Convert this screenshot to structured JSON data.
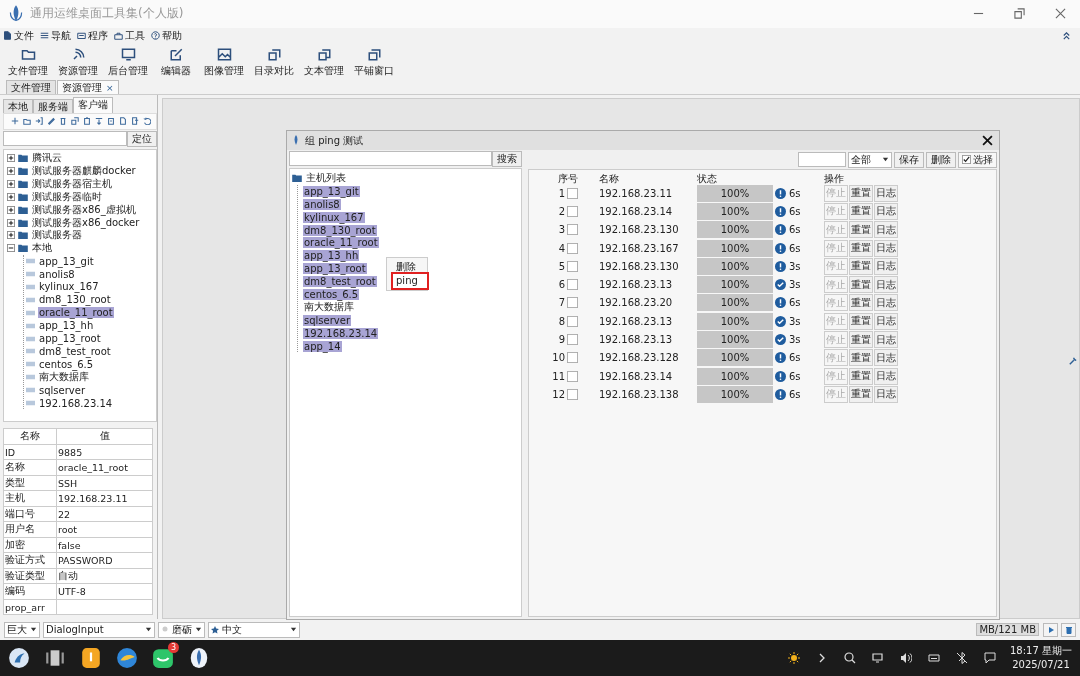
{
  "window": {
    "title": "通用运维桌面工具集(个人版)"
  },
  "menu": [
    "文件",
    "导航",
    "程序",
    "工具",
    "帮助"
  ],
  "toolbar": [
    "文件管理",
    "资源管理",
    "后台管理",
    "编辑器",
    "图像管理",
    "目录对比",
    "文本管理",
    "平铺窗口"
  ],
  "doc_tabs": [
    {
      "label": "文件管理",
      "selected": false
    },
    {
      "label": "资源管理",
      "selected": true,
      "close": "×"
    }
  ],
  "left_panel": {
    "tabs": [
      {
        "label": "本地",
        "selected": false
      },
      {
        "label": "服务端",
        "selected": false
      },
      {
        "label": "客户端",
        "selected": true
      }
    ],
    "locate_button": "定位",
    "tree": [
      {
        "label": "腾讯云",
        "expanded": false
      },
      {
        "label": "测试服务器麒麟docker",
        "expanded": false
      },
      {
        "label": "测试服务器宿主机",
        "expanded": false
      },
      {
        "label": "测试服务器临时",
        "expanded": false
      },
      {
        "label": "测试服务器x86_虚拟机",
        "expanded": false
      },
      {
        "label": "测试服务器x86_docker",
        "expanded": false
      },
      {
        "label": "测试服务器",
        "expanded": false
      },
      {
        "label": "本地",
        "expanded": true,
        "children": [
          {
            "label": "app_13_git",
            "selected": false
          },
          {
            "label": "anolis8",
            "selected": false
          },
          {
            "label": "kylinux_167",
            "selected": false
          },
          {
            "label": "dm8_130_root",
            "selected": false
          },
          {
            "label": "oracle_11_root",
            "selected": true
          },
          {
            "label": "app_13_hh",
            "selected": false
          },
          {
            "label": "app_13_root",
            "selected": false
          },
          {
            "label": "dm8_test_root",
            "selected": false
          },
          {
            "label": "centos_6.5",
            "selected": false
          },
          {
            "label": "南大数据库",
            "selected": false
          },
          {
            "label": "sqlserver",
            "selected": false
          },
          {
            "label": "192.168.23.14",
            "selected": false
          }
        ]
      }
    ],
    "properties": {
      "columns": [
        "名称",
        "值"
      ],
      "rows": [
        {
          "key": "ID",
          "value": "9885"
        },
        {
          "key": "名称",
          "value": "oracle_11_root"
        },
        {
          "key": "类型",
          "value": "SSH"
        },
        {
          "key": "主机",
          "value": "192.168.23.11"
        },
        {
          "key": "端口号",
          "value": "22"
        },
        {
          "key": "用户名",
          "value": "root"
        },
        {
          "key": "加密",
          "value": "false"
        },
        {
          "key": "验证方式",
          "value": "PASSWORD"
        },
        {
          "key": "验证类型",
          "value": "自动"
        },
        {
          "key": "编码",
          "value": "UTF-8"
        },
        {
          "key": "prop_arr"
        }
      ]
    }
  },
  "dialog": {
    "title": "组 ping 测试",
    "search_button": "搜索",
    "tree": {
      "label": "主机列表",
      "children": [
        {
          "label": "app_13_git",
          "selected": true
        },
        {
          "label": "anolis8",
          "selected": true
        },
        {
          "label": "kylinux_167",
          "selected": true
        },
        {
          "label": "dm8_130_root",
          "selected": true
        },
        {
          "label": "oracle_11_root",
          "selected": true
        },
        {
          "label": "app_13_hh",
          "selected": true
        },
        {
          "label": "app_13_root",
          "selected": true
        },
        {
          "label": "dm8_test_root",
          "selected": true
        },
        {
          "label": "centos_6.5",
          "selected": true
        },
        {
          "label": "南大数据库",
          "selected": false
        },
        {
          "label": "sqlserver",
          "selected": true
        },
        {
          "label": "192.168.23.14",
          "selected": true
        },
        {
          "label": "app_14",
          "selected": true
        }
      ]
    },
    "context_menu": [
      {
        "label": "删除",
        "highlighted": false
      },
      {
        "label": "ping",
        "highlighted": true
      }
    ],
    "filter": "全部",
    "buttons": [
      "保存",
      "删除"
    ],
    "select_all": {
      "label": "选择",
      "checked": true
    },
    "table": {
      "columns": [
        "序号",
        "名称",
        "状态",
        "操作"
      ],
      "rows": [
        {
          "index": "1",
          "checked": false,
          "name": "192.168.23.11",
          "level": 1,
          "progress": "100%",
          "kind": "warning",
          "time": "6s",
          "actions": [
            {
              "label": "停止",
              "disabled": true
            },
            {
              "label": "重置",
              "disabled": false
            },
            {
              "label": "日志",
              "disabled": false
            }
          ]
        },
        {
          "index": "2",
          "checked": false,
          "name": "192.168.23.14",
          "level": 1,
          "progress": "100%",
          "kind": "warning",
          "time": "6s",
          "actions": [
            {
              "label": "停止",
              "disabled": true
            },
            {
              "label": "重置",
              "disabled": false
            },
            {
              "label": "日志",
              "disabled": false
            }
          ]
        },
        {
          "index": "3",
          "checked": false,
          "name": "192.168.23.130",
          "level": 1,
          "progress": "100%",
          "kind": "warning",
          "time": "6s",
          "actions": [
            {
              "label": "停止",
              "disabled": true
            },
            {
              "label": "重置",
              "disabled": false
            },
            {
              "label": "日志",
              "disabled": false
            }
          ]
        },
        {
          "index": "4",
          "checked": false,
          "name": "192.168.23.167",
          "level": 1,
          "progress": "100%",
          "kind": "warning",
          "time": "6s",
          "actions": [
            {
              "label": "停止",
              "disabled": true
            },
            {
              "label": "重置",
              "disabled": false
            },
            {
              "label": "日志",
              "disabled": false
            }
          ]
        },
        {
          "index": "5",
          "checked": false,
          "name": "192.168.23.130",
          "level": 1,
          "progress": "100%",
          "kind": "warning",
          "time": "3s",
          "actions": [
            {
              "label": "停止",
              "disabled": true
            },
            {
              "label": "重置",
              "disabled": false
            },
            {
              "label": "日志",
              "disabled": false
            }
          ]
        },
        {
          "index": "6",
          "checked": false,
          "name": "192.168.23.13",
          "level": 1,
          "progress": "100%",
          "kind": "success",
          "time": "3s",
          "actions": [
            {
              "label": "停止",
              "disabled": true
            },
            {
              "label": "重置",
              "disabled": false
            },
            {
              "label": "日志",
              "disabled": false
            }
          ]
        },
        {
          "index": "7",
          "checked": false,
          "name": "192.168.23.20",
          "level": 1,
          "progress": "100%",
          "kind": "warning",
          "time": "6s",
          "actions": [
            {
              "label": "停止",
              "disabled": true
            },
            {
              "label": "重置",
              "disabled": false
            },
            {
              "label": "日志",
              "disabled": false
            }
          ]
        },
        {
          "index": "8",
          "checked": false,
          "name": "192.168.23.13",
          "level": 1,
          "progress": "100%",
          "kind": "success",
          "time": "3s",
          "actions": [
            {
              "label": "停止",
              "disabled": true
            },
            {
              "label": "重置",
              "disabled": false
            },
            {
              "label": "日志",
              "disabled": false
            }
          ]
        },
        {
          "index": "9",
          "checked": false,
          "name": "192.168.23.13",
          "level": 1,
          "progress": "100%",
          "kind": "success",
          "time": "3s",
          "actions": [
            {
              "label": "停止",
              "disabled": true
            },
            {
              "label": "重置",
              "disabled": false
            },
            {
              "label": "日志",
              "disabled": false
            }
          ]
        },
        {
          "index": "10",
          "checked": false,
          "name": "192.168.23.128",
          "level": 1,
          "progress": "100%",
          "kind": "warning",
          "time": "6s",
          "actions": [
            {
              "label": "停止",
              "disabled": true
            },
            {
              "label": "重置",
              "disabled": false
            },
            {
              "label": "日志",
              "disabled": false
            }
          ]
        },
        {
          "index": "11",
          "checked": false,
          "name": "192.168.23.14",
          "level": 1,
          "progress": "100%",
          "kind": "warning",
          "time": "6s",
          "actions": [
            {
              "label": "停止",
              "disabled": true
            },
            {
              "label": "重置",
              "disabled": false
            },
            {
              "label": "日志",
              "disabled": false
            }
          ]
        },
        {
          "index": "12",
          "checked": false,
          "name": "192.168.23.138",
          "level": 1,
          "progress": "100%",
          "kind": "warning",
          "time": "6s",
          "actions": [
            {
              "label": "停止",
              "disabled": true
            },
            {
              "label": "重置",
              "disabled": false
            },
            {
              "label": "日志",
              "disabled": false
            }
          ]
        }
      ]
    }
  },
  "status_bar": {
    "size": "巨大",
    "font": "DialogInput",
    "theme": "磨砺",
    "language": "中文",
    "memory": "MB/121 MB"
  },
  "taskbar": {
    "badge": "3",
    "time": "18:17 星期一",
    "date": "2025/07/21"
  }
}
